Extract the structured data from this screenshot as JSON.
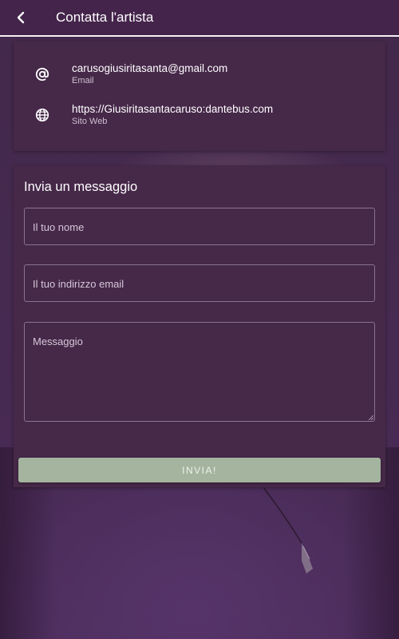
{
  "appbar": {
    "title": "Contatta l'artista",
    "back_icon": "chevron-left-icon"
  },
  "contact_info": {
    "items": [
      {
        "icon": "at-sign-icon",
        "value": "carusogiusiritasanta@gmail.com",
        "label": "Email"
      },
      {
        "icon": "globe-icon",
        "value": "https://Giusiritasantacaruso:dantebus.com",
        "label": "Sito Web"
      }
    ]
  },
  "form": {
    "title": "Invia un messaggio",
    "name_placeholder": "Il tuo nome",
    "email_placeholder": "Il tuo indirizzo email",
    "message_placeholder": "Messaggio",
    "submit_label": "INVIA!"
  },
  "colors": {
    "background": "#3e2446",
    "appbar": "#44244b",
    "card": "#462849",
    "submit_button": "#a4b49e"
  }
}
